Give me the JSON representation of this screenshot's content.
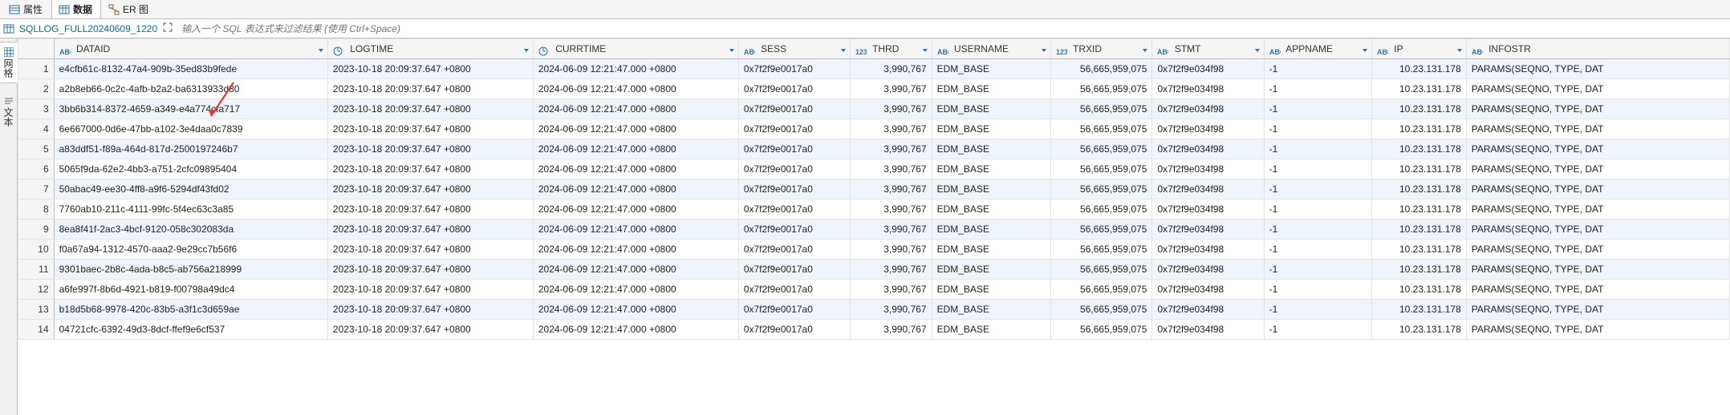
{
  "tabs": {
    "attributes": "属性",
    "data": "数据",
    "er": "ER 图"
  },
  "toolbar": {
    "table_name": "SQLLOG_FULL20240609_1220",
    "filter_placeholder": "输入一个 SQL 表达式来过滤结果 (使用 Ctrl+Space)"
  },
  "vtabs": {
    "grid": "网格",
    "text": "文本"
  },
  "columns": {
    "dataid": "DATAID",
    "logtime": "LOGTIME",
    "currtime": "CURRTIME",
    "sess": "SESS",
    "thrd": "THRD",
    "username": "USERNAME",
    "trxid": "TRXID",
    "stmt": "STMT",
    "appname": "APPNAME",
    "ip": "IP",
    "infostr": "INFOSTR"
  },
  "rows": [
    {
      "n": "1",
      "dataid": "e4cfb61c-8132-47a4-909b-35ed83b9fede",
      "logtime": "2023-10-18 20:09:37.647 +0800",
      "currtime": "2024-06-09 12:21:47.000 +0800",
      "sess": "0x7f2f9e0017a0",
      "thrd": "3,990,767",
      "username": "EDM_BASE",
      "trxid": "56,665,959,075",
      "stmt": "0x7f2f9e034f98",
      "appname": "-1",
      "ip": "10.23.131.178",
      "infostr": "PARAMS(SEQNO, TYPE, DAT"
    },
    {
      "n": "2",
      "dataid": "a2b8eb66-0c2c-4afb-b2a2-ba6313933d80",
      "logtime": "2023-10-18 20:09:37.647 +0800",
      "currtime": "2024-06-09 12:21:47.000 +0800",
      "sess": "0x7f2f9e0017a0",
      "thrd": "3,990,767",
      "username": "EDM_BASE",
      "trxid": "56,665,959,075",
      "stmt": "0x7f2f9e034f98",
      "appname": "-1",
      "ip": "10.23.131.178",
      "infostr": "PARAMS(SEQNO, TYPE, DAT"
    },
    {
      "n": "3",
      "dataid": "3bb6b314-8372-4659-a349-e4a774cfa717",
      "logtime": "2023-10-18 20:09:37.647 +0800",
      "currtime": "2024-06-09 12:21:47.000 +0800",
      "sess": "0x7f2f9e0017a0",
      "thrd": "3,990,767",
      "username": "EDM_BASE",
      "trxid": "56,665,959,075",
      "stmt": "0x7f2f9e034f98",
      "appname": "-1",
      "ip": "10.23.131.178",
      "infostr": "PARAMS(SEQNO, TYPE, DAT"
    },
    {
      "n": "4",
      "dataid": "6e667000-0d6e-47bb-a102-3e4daa0c7839",
      "logtime": "2023-10-18 20:09:37.647 +0800",
      "currtime": "2024-06-09 12:21:47.000 +0800",
      "sess": "0x7f2f9e0017a0",
      "thrd": "3,990,767",
      "username": "EDM_BASE",
      "trxid": "56,665,959,075",
      "stmt": "0x7f2f9e034f98",
      "appname": "-1",
      "ip": "10.23.131.178",
      "infostr": "PARAMS(SEQNO, TYPE, DAT"
    },
    {
      "n": "5",
      "dataid": "a83ddf51-f89a-464d-817d-2500197246b7",
      "logtime": "2023-10-18 20:09:37.647 +0800",
      "currtime": "2024-06-09 12:21:47.000 +0800",
      "sess": "0x7f2f9e0017a0",
      "thrd": "3,990,767",
      "username": "EDM_BASE",
      "trxid": "56,665,959,075",
      "stmt": "0x7f2f9e034f98",
      "appname": "-1",
      "ip": "10.23.131.178",
      "infostr": "PARAMS(SEQNO, TYPE, DAT"
    },
    {
      "n": "6",
      "dataid": "5065f9da-62e2-4bb3-a751-2cfc09895404",
      "logtime": "2023-10-18 20:09:37.647 +0800",
      "currtime": "2024-06-09 12:21:47.000 +0800",
      "sess": "0x7f2f9e0017a0",
      "thrd": "3,990,767",
      "username": "EDM_BASE",
      "trxid": "56,665,959,075",
      "stmt": "0x7f2f9e034f98",
      "appname": "-1",
      "ip": "10.23.131.178",
      "infostr": "PARAMS(SEQNO, TYPE, DAT"
    },
    {
      "n": "7",
      "dataid": "50abac49-ee30-4ff8-a9f6-5294df43fd02",
      "logtime": "2023-10-18 20:09:37.647 +0800",
      "currtime": "2024-06-09 12:21:47.000 +0800",
      "sess": "0x7f2f9e0017a0",
      "thrd": "3,990,767",
      "username": "EDM_BASE",
      "trxid": "56,665,959,075",
      "stmt": "0x7f2f9e034f98",
      "appname": "-1",
      "ip": "10.23.131.178",
      "infostr": "PARAMS(SEQNO, TYPE, DAT"
    },
    {
      "n": "8",
      "dataid": "7760ab10-211c-4111-99fc-5f4ec63c3a85",
      "logtime": "2023-10-18 20:09:37.647 +0800",
      "currtime": "2024-06-09 12:21:47.000 +0800",
      "sess": "0x7f2f9e0017a0",
      "thrd": "3,990,767",
      "username": "EDM_BASE",
      "trxid": "56,665,959,075",
      "stmt": "0x7f2f9e034f98",
      "appname": "-1",
      "ip": "10.23.131.178",
      "infostr": "PARAMS(SEQNO, TYPE, DAT"
    },
    {
      "n": "9",
      "dataid": "8ea8f41f-2ac3-4bcf-9120-058c302083da",
      "logtime": "2023-10-18 20:09:37.647 +0800",
      "currtime": "2024-06-09 12:21:47.000 +0800",
      "sess": "0x7f2f9e0017a0",
      "thrd": "3,990,767",
      "username": "EDM_BASE",
      "trxid": "56,665,959,075",
      "stmt": "0x7f2f9e034f98",
      "appname": "-1",
      "ip": "10.23.131.178",
      "infostr": "PARAMS(SEQNO, TYPE, DAT"
    },
    {
      "n": "10",
      "dataid": "f0a67a94-1312-4570-aaa2-9e29cc7b56f6",
      "logtime": "2023-10-18 20:09:37.647 +0800",
      "currtime": "2024-06-09 12:21:47.000 +0800",
      "sess": "0x7f2f9e0017a0",
      "thrd": "3,990,767",
      "username": "EDM_BASE",
      "trxid": "56,665,959,075",
      "stmt": "0x7f2f9e034f98",
      "appname": "-1",
      "ip": "10.23.131.178",
      "infostr": "PARAMS(SEQNO, TYPE, DAT"
    },
    {
      "n": "11",
      "dataid": "9301baec-2b8c-4ada-b8c5-ab756a218999",
      "logtime": "2023-10-18 20:09:37.647 +0800",
      "currtime": "2024-06-09 12:21:47.000 +0800",
      "sess": "0x7f2f9e0017a0",
      "thrd": "3,990,767",
      "username": "EDM_BASE",
      "trxid": "56,665,959,075",
      "stmt": "0x7f2f9e034f98",
      "appname": "-1",
      "ip": "10.23.131.178",
      "infostr": "PARAMS(SEQNO, TYPE, DAT"
    },
    {
      "n": "12",
      "dataid": "a6fe997f-8b6d-4921-b819-f00798a49dc4",
      "logtime": "2023-10-18 20:09:37.647 +0800",
      "currtime": "2024-06-09 12:21:47.000 +0800",
      "sess": "0x7f2f9e0017a0",
      "thrd": "3,990,767",
      "username": "EDM_BASE",
      "trxid": "56,665,959,075",
      "stmt": "0x7f2f9e034f98",
      "appname": "-1",
      "ip": "10.23.131.178",
      "infostr": "PARAMS(SEQNO, TYPE, DAT"
    },
    {
      "n": "13",
      "dataid": "b18d5b68-9978-420c-83b5-a3f1c3d659ae",
      "logtime": "2023-10-18 20:09:37.647 +0800",
      "currtime": "2024-06-09 12:21:47.000 +0800",
      "sess": "0x7f2f9e0017a0",
      "thrd": "3,990,767",
      "username": "EDM_BASE",
      "trxid": "56,665,959,075",
      "stmt": "0x7f2f9e034f98",
      "appname": "-1",
      "ip": "10.23.131.178",
      "infostr": "PARAMS(SEQNO, TYPE, DAT"
    },
    {
      "n": "14",
      "dataid": "04721cfc-6392-49d3-8dcf-ffef9e6cf537",
      "logtime": "2023-10-18 20:09:37.647 +0800",
      "currtime": "2024-06-09 12:21:47.000 +0800",
      "sess": "0x7f2f9e0017a0",
      "thrd": "3,990,767",
      "username": "EDM_BASE",
      "trxid": "56,665,959,075",
      "stmt": "0x7f2f9e034f98",
      "appname": "-1",
      "ip": "10.23.131.178",
      "infostr": "PARAMS(SEQNO, TYPE, DAT"
    }
  ]
}
